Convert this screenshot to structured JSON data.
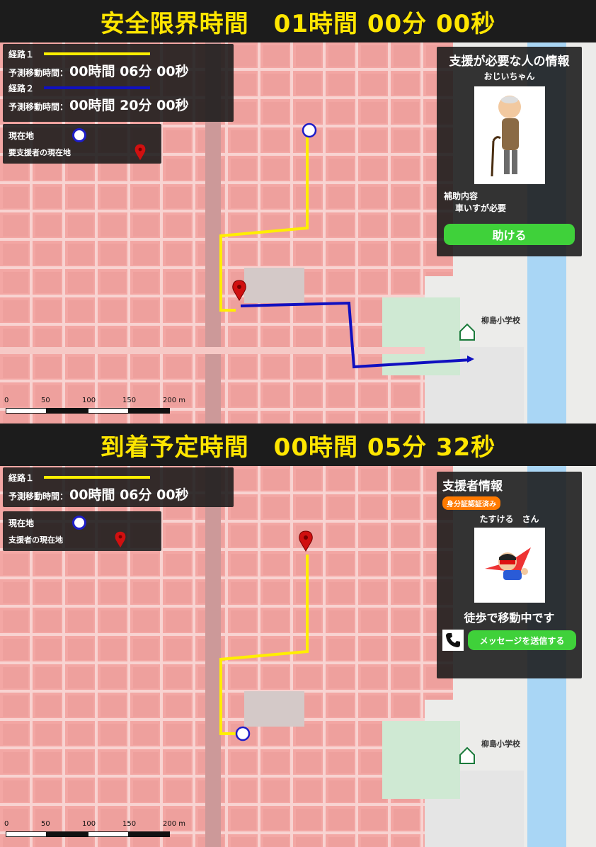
{
  "top": {
    "title": "安全限界時間　01時間 00分 00秒",
    "legend": {
      "route1_label": "経路１",
      "route1_eta_prefix": "予測移動時間：",
      "route1_eta_value": "00時間 06分 00秒",
      "route2_label": "経路２",
      "route2_eta_prefix": "予測移動時間：",
      "route2_eta_value": "00時間 20分 00秒",
      "current_location": "現在地",
      "person_location": "要支援者の現在地"
    },
    "info": {
      "title": "支援が必要な人の情報",
      "name": "おじいちゃん",
      "assist_label": "補助内容",
      "assist_value": "車いすが必要",
      "help_button": "助ける"
    },
    "school_label": "柳島小学校"
  },
  "bottom": {
    "title": "到着予定時間　00時間 05分 32秒",
    "legend": {
      "route1_label": "経路１",
      "route1_eta_prefix": "予測移動時間：",
      "route1_eta_value": "00時間 06分 00秒",
      "current_location": "現在地",
      "helper_location": "支援者の現在地"
    },
    "info": {
      "title": "支援者情報",
      "verified_badge": "身分証認証済み",
      "name": "たすける　さん",
      "status": "徒歩で移動中です",
      "message_button": "メッセージを送信する"
    },
    "school_label": "柳島小学校"
  },
  "scale": {
    "ticks": [
      "0",
      "50",
      "100",
      "150",
      "200 m"
    ]
  },
  "colors": {
    "route1": "#ffee00",
    "route2": "#1010c0",
    "title_text": "#ffe600",
    "button_green": "#3fd13a",
    "badge_orange": "#ff7a00",
    "hazard": "#f08a8a"
  },
  "icons": [
    "location-pin-icon",
    "current-location-icon",
    "phone-icon",
    "school-icon",
    "elderly-man-illustration",
    "superhero-illustration"
  ]
}
